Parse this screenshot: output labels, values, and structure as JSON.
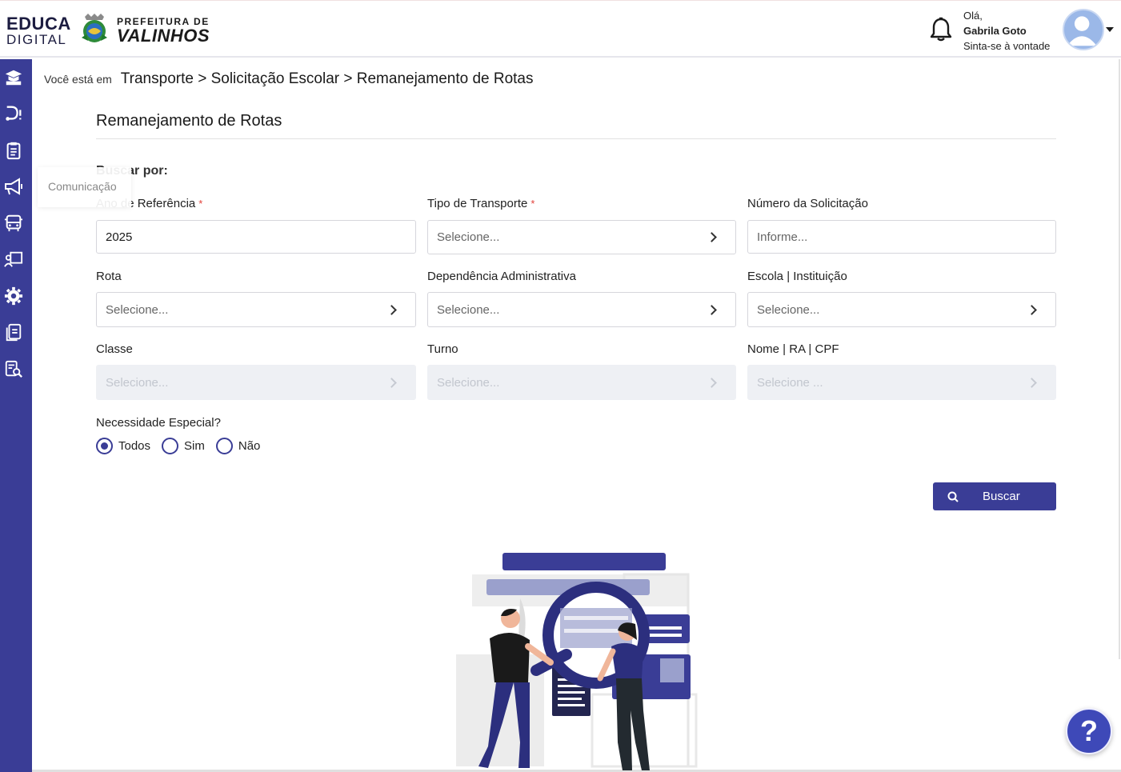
{
  "header": {
    "logo_line1": "EDUCA",
    "logo_line2": "DIGITAL",
    "pref_line1": "PREFEITURA DE",
    "pref_line2": "VALINHOS",
    "greeting": "Olá,",
    "user_name": "Gabrila Goto",
    "user_subtitle": "Sinta-se à vontade"
  },
  "sidebar": {
    "tooltip": "Comunicação",
    "icons": [
      "graduate-icon",
      "route-icon",
      "clipboard-icon",
      "megaphone-icon",
      "bus-icon",
      "teacher-board-icon",
      "gear-icon",
      "documents-icon",
      "report-search-icon"
    ]
  },
  "breadcrumb": {
    "prefix": "Você está em",
    "path": "Transporte > Solicitação Escolar > Remanejamento de Rotas"
  },
  "page": {
    "title": "Remanejamento de Rotas",
    "search_by": "Buscar por:"
  },
  "form": {
    "ano": {
      "label": "Ano de Referência",
      "required": "*",
      "value": "2025"
    },
    "tipo": {
      "label": "Tipo de Transporte",
      "required": "*",
      "placeholder": "Selecione..."
    },
    "numero": {
      "label": "Número da Solicitação",
      "placeholder": "Informe..."
    },
    "rota": {
      "label": "Rota",
      "placeholder": "Selecione..."
    },
    "dependencia": {
      "label": "Dependência Administrativa",
      "placeholder": "Selecione..."
    },
    "escola": {
      "label": "Escola | Instituição",
      "placeholder": "Selecione..."
    },
    "classe": {
      "label": "Classe",
      "placeholder": "Selecione..."
    },
    "turno": {
      "label": "Turno",
      "placeholder": "Selecione..."
    },
    "nome": {
      "label": "Nome | RA | CPF",
      "placeholder": "Selecione ..."
    },
    "necessidade": {
      "label": "Necessidade Especial?",
      "options": [
        "Todos",
        "Sim",
        "Não"
      ],
      "selected": "Todos"
    }
  },
  "actions": {
    "search_label": "Buscar"
  },
  "help": {
    "label": "?"
  },
  "colors": {
    "primary": "#3a3d96",
    "required": "#e2413a",
    "help": "#3e49b8"
  }
}
